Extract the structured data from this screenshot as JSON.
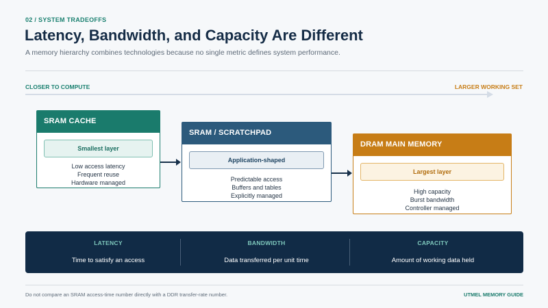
{
  "header": {
    "eyebrow": "02 / SYSTEM TRADEOFFS",
    "title": "Latency, Bandwidth, and Capacity Are Different",
    "subtitle": "A memory hierarchy combines technologies because no single metric defines system performance."
  },
  "axis": {
    "left_label": "CLOSER TO COMPUTE",
    "right_label": "LARGER WORKING SET"
  },
  "tiers": [
    {
      "name": "SRAM CACHE",
      "tag": "Smallest layer",
      "lines": [
        "Low access latency",
        "Frequent reuse",
        "Hardware managed"
      ],
      "color": "#1a7b6c"
    },
    {
      "name": "SRAM / SCRATCHPAD",
      "tag": "Application-shaped",
      "lines": [
        "Predictable access",
        "Buffers and tables",
        "Explicitly managed"
      ],
      "color": "#2c5a7c"
    },
    {
      "name": "DRAM MAIN MEMORY",
      "tag": "Largest layer",
      "lines": [
        "High capacity",
        "Burst bandwidth",
        "Controller managed"
      ],
      "color": "#c77d16"
    }
  ],
  "metrics": [
    {
      "label": "LATENCY",
      "description": "Time to satisfy an access"
    },
    {
      "label": "BANDWIDTH",
      "description": "Data transferred per unit time"
    },
    {
      "label": "CAPACITY",
      "description": "Amount of working data held"
    }
  ],
  "footer": {
    "note": "Do not compare an SRAM access-time number directly with a DDR transfer-rate number.",
    "brand": "UTMEL MEMORY GUIDE"
  }
}
